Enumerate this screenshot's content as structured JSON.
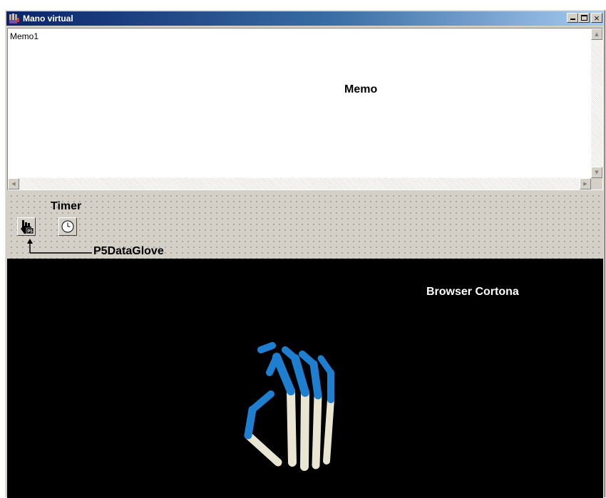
{
  "window": {
    "title": "Mano virtual",
    "controls": [
      "minimize",
      "maximize",
      "close"
    ],
    "close_glyph": "×"
  },
  "memo": {
    "text": "Memo1",
    "annotation": "Memo"
  },
  "design_area": {
    "components": [
      {
        "name": "P5DataGlove",
        "icon": "hand-p5-icon",
        "badge": "P5"
      },
      {
        "name": "Timer",
        "icon": "clock-icon"
      }
    ],
    "timer_label": "Timer",
    "glove_label": "P5DataGlove"
  },
  "browser": {
    "label": "Browser Cortona",
    "background": "#000000",
    "hand_colors": {
      "tip": "#1e7fd0",
      "base": "#e8e6d2"
    }
  },
  "colors": {
    "titlebar_start": "#0a246a",
    "titlebar_end": "#a6caf0",
    "face": "#d4d0c8"
  }
}
